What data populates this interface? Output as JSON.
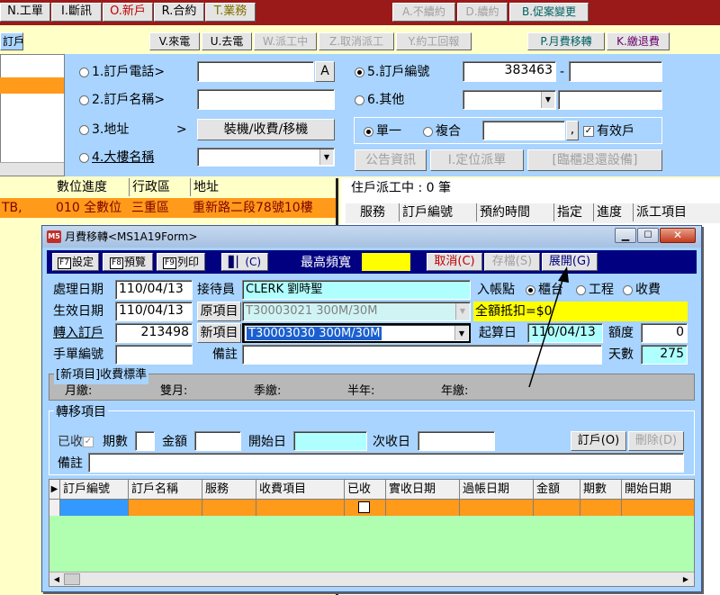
{
  "top_menu": [
    {
      "label": "N.工單"
    },
    {
      "label": "I.斷訊"
    },
    {
      "label": "O.新戶"
    },
    {
      "label": "R.合約"
    },
    {
      "label": "T.業務"
    }
  ],
  "top_menu_right": [
    {
      "label": "A.不續約"
    },
    {
      "label": "D.續約"
    },
    {
      "label": "B.促案變更"
    }
  ],
  "tab_left": "訂戶",
  "toolbar2": [
    {
      "label": "V.來電"
    },
    {
      "label": "U.去電"
    },
    {
      "label": "W.派工中"
    },
    {
      "label": "Z.取消派工"
    },
    {
      "label": "Y.約工回報"
    }
  ],
  "toolbar2_right": [
    {
      "label": "P.月費移轉"
    },
    {
      "label": "K.繳退費"
    }
  ],
  "search": {
    "phone_label": "1.訂戶電話>",
    "name_label": "2.訂戶名稱>",
    "addr_label": "3.地址",
    "addr_arrow": ">",
    "building_label": "4.大樓名稱",
    "install_btn": "裝機/收費/移機",
    "a_btn": "A",
    "subno_label": "5.訂戶編號",
    "subno_value": "383463",
    "subno_dash": "-",
    "other_label": "6.其他",
    "single": "單一",
    "multi": "複合",
    "comma": ",",
    "valid": "有效戶",
    "announce": "公告資訊",
    "locate": "I.定位派單",
    "counter": "[臨櫃退還設備]"
  },
  "left_table": {
    "headers": [
      "數位進度",
      "行政區",
      "地址"
    ],
    "row": [
      "TB,",
      "010  全數位",
      "三重區",
      "重新路二段78號10樓"
    ]
  },
  "dispatch": {
    "title": "住戶派工中 : 0 筆",
    "headers": [
      "服務",
      "訂戶編號",
      "預約時間",
      "指定",
      "進度",
      "派工項目"
    ]
  },
  "dialog": {
    "icon_label": "M5",
    "title": "月費移轉<MS1A19Form>",
    "toolbar": {
      "f7": "F7",
      "set": "設定",
      "f8": "F8",
      "preview": "預覽",
      "f9": "F9",
      "print": "列印",
      "c_btn": "(C)",
      "bandwidth_label": "最高頻寬",
      "cancel": "取消(C)",
      "save": "存檔(S)",
      "expand": "展開(G)"
    },
    "form": {
      "proc_date_label": "處理日期",
      "proc_date": "110/04/13",
      "receiver_label": "接待員",
      "receiver": "CLERK 劉時聖",
      "account_label": "入帳點",
      "opt_counter": "櫃台",
      "opt_eng": "工程",
      "opt_fee": "收費",
      "eff_date_label": "生效日期",
      "eff_date": "110/04/13",
      "orig_label": "原項目",
      "orig": "T30003021 300M/30M",
      "full_amount": "全額抵扣=$0",
      "transfer_label": "轉入訂戶",
      "transfer": "213498",
      "new_label": "新項目",
      "new_item": "T30003030 300M/30M",
      "start_label": "起算日",
      "start": "110/04/13",
      "quota_label": "額度",
      "quota": "0",
      "manual_label": "手單編號",
      "remark_label": "備註",
      "days_label": "天數",
      "days": "275"
    },
    "fee": {
      "title": "[新項目]收費標準",
      "monthly": "月繳:",
      "bimonthly": "雙月:",
      "quarterly": "季繳:",
      "half": "半年:",
      "yearly": "年繳:"
    },
    "transfer": {
      "title": "轉移項目",
      "paid": "已收",
      "periods": "期數",
      "amount": "金額",
      "start": "開始日",
      "next": "次收日",
      "sub_btn": "訂戶(O)",
      "del_btn": "刪除(D)",
      "remark": "備註"
    },
    "grid_headers": [
      "訂戶編號",
      "訂戶名稱",
      "服務",
      "收費項目",
      "已收",
      "實收日期",
      "過帳日期",
      "金額",
      "期數",
      "開始日期"
    ]
  }
}
